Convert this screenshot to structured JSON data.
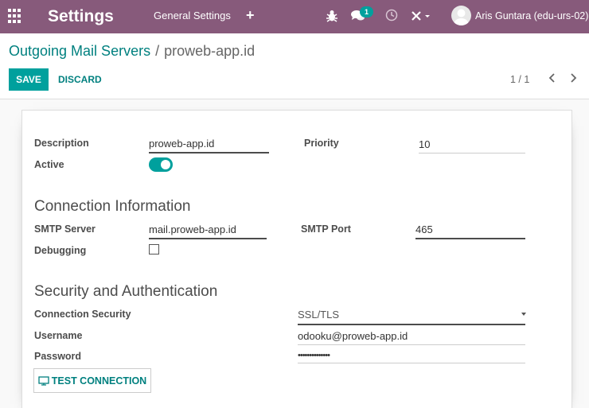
{
  "navbar": {
    "brand": "Settings",
    "menu_item": "General Settings",
    "plus": "+",
    "chat_badge": "1",
    "user_name": "Aris Guntara (edu-urs-02)"
  },
  "breadcrumb": {
    "parent": "Outgoing Mail Servers",
    "separator": "/",
    "current": "proweb-app.id"
  },
  "buttons": {
    "save": "SAVE",
    "discard": "DISCARD",
    "test_connection": "TEST CONNECTION"
  },
  "pager": {
    "text": "1 / 1"
  },
  "form": {
    "description_label": "Description",
    "description_value": "proweb-app.id",
    "priority_label": "Priority",
    "priority_value": "10",
    "active_label": "Active",
    "active_on": true,
    "connection_title": "Connection Information",
    "smtp_server_label": "SMTP Server",
    "smtp_server_value": "mail.proweb-app.id",
    "smtp_port_label": "SMTP Port",
    "smtp_port_value": "465",
    "debugging_label": "Debugging",
    "debugging_checked": false,
    "security_title": "Security and Authentication",
    "connection_security_label": "Connection Security",
    "connection_security_value": "SSL/TLS",
    "username_label": "Username",
    "username_value": "odooku@proweb-app.id",
    "password_label": "Password",
    "password_value": "••••••••••••••"
  },
  "colors": {
    "navbar": "#875a7b",
    "primary": "#00a09d",
    "link": "#00807f"
  }
}
